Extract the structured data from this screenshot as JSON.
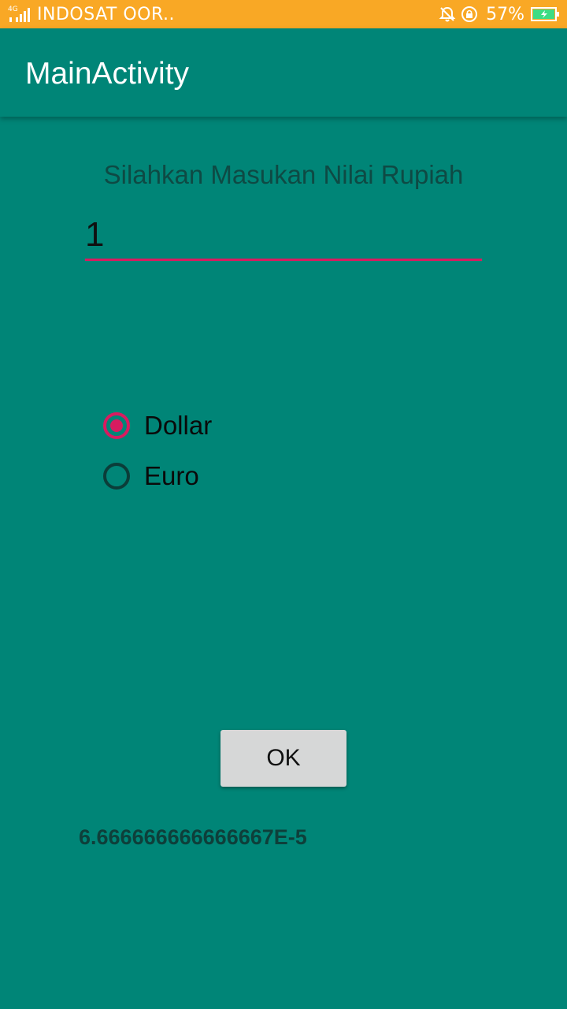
{
  "status_bar": {
    "network_type": "4G",
    "carrier": "INDOSAT OOR..",
    "battery_percent": "57%",
    "colors": {
      "background": "#F9A825",
      "battery_fill": "#3DDC84"
    }
  },
  "app_bar": {
    "title": "MainActivity"
  },
  "form": {
    "prompt": "Silahkan Masukan Nilai Rupiah",
    "amount_value": "1",
    "options": [
      {
        "label": "Dollar",
        "selected": true
      },
      {
        "label": "Euro",
        "selected": false
      }
    ],
    "ok_label": "OK",
    "result": "6.666666666666667E-5"
  },
  "theme": {
    "primary": "#008577",
    "accent": "#D81B60"
  }
}
